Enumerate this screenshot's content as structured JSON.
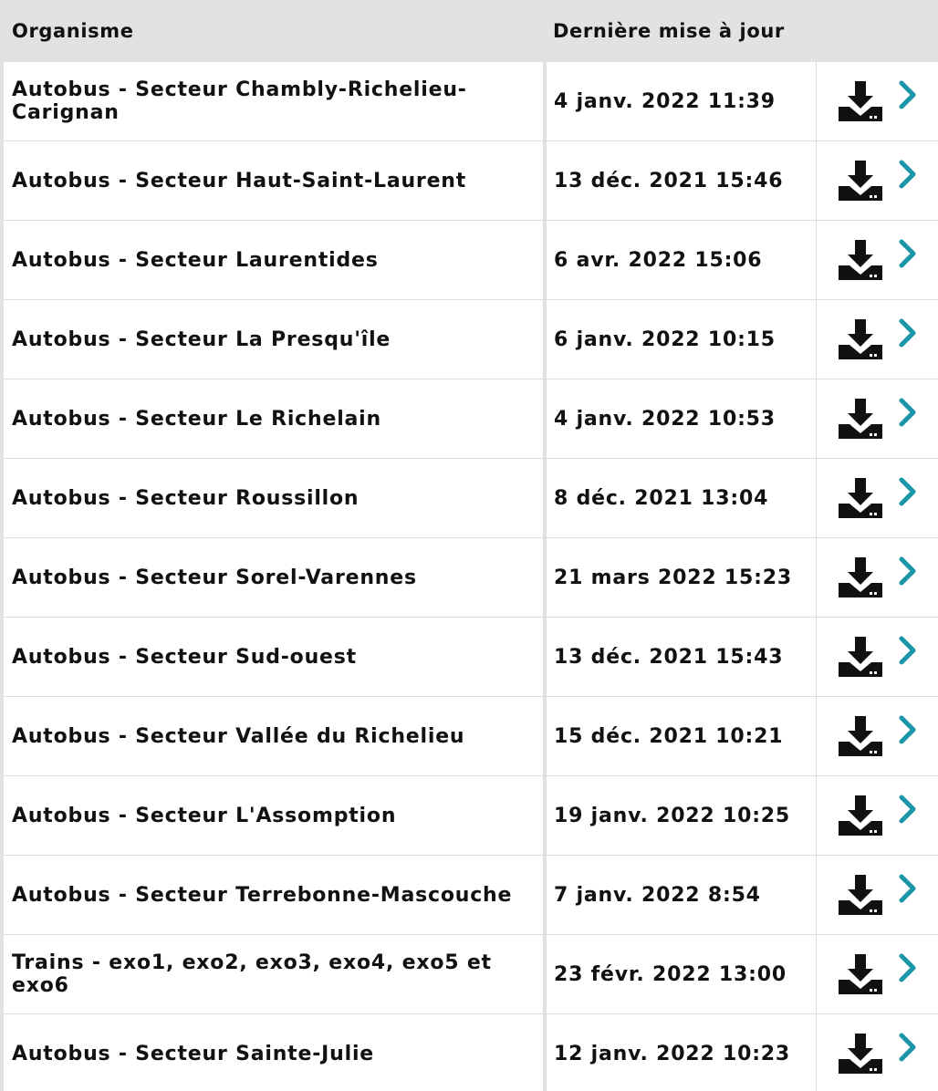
{
  "header": {
    "col_org": "Organisme",
    "col_date": "Dernière mise à jour"
  },
  "icons": {
    "download": "download-icon",
    "detail": "chevron-right-icon"
  },
  "colors": {
    "header_bg": "#e2e2e2",
    "chevron": "#1a96a8",
    "icon": "#111111"
  },
  "rows": [
    {
      "org": "Autobus - Secteur Chambly-Richelieu-Carignan",
      "date": "4 janv. 2022 11:39"
    },
    {
      "org": "Autobus - Secteur Haut-Saint-Laurent",
      "date": "13 déc. 2021 15:46"
    },
    {
      "org": "Autobus - Secteur Laurentides",
      "date": "6 avr. 2022 15:06"
    },
    {
      "org": "Autobus - Secteur La Presqu'île",
      "date": "6 janv. 2022 10:15"
    },
    {
      "org": "Autobus - Secteur Le Richelain",
      "date": "4 janv. 2022 10:53"
    },
    {
      "org": "Autobus - Secteur Roussillon",
      "date": "8 déc. 2021 13:04"
    },
    {
      "org": "Autobus - Secteur Sorel-Varennes",
      "date": "21 mars 2022 15:23"
    },
    {
      "org": "Autobus - Secteur Sud-ouest",
      "date": "13 déc. 2021 15:43"
    },
    {
      "org": "Autobus - Secteur Vallée du Richelieu",
      "date": "15 déc. 2021 10:21"
    },
    {
      "org": "Autobus - Secteur L'Assomption",
      "date": "19 janv. 2022 10:25"
    },
    {
      "org": "Autobus - Secteur Terrebonne-Mascouche",
      "date": "7 janv. 2022 8:54"
    },
    {
      "org": "Trains - exo1, exo2, exo3, exo4, exo5 et exo6",
      "date": "23 févr. 2022 13:00"
    },
    {
      "org": "Autobus - Secteur Sainte-Julie",
      "date": "12 janv. 2022 10:23"
    }
  ]
}
